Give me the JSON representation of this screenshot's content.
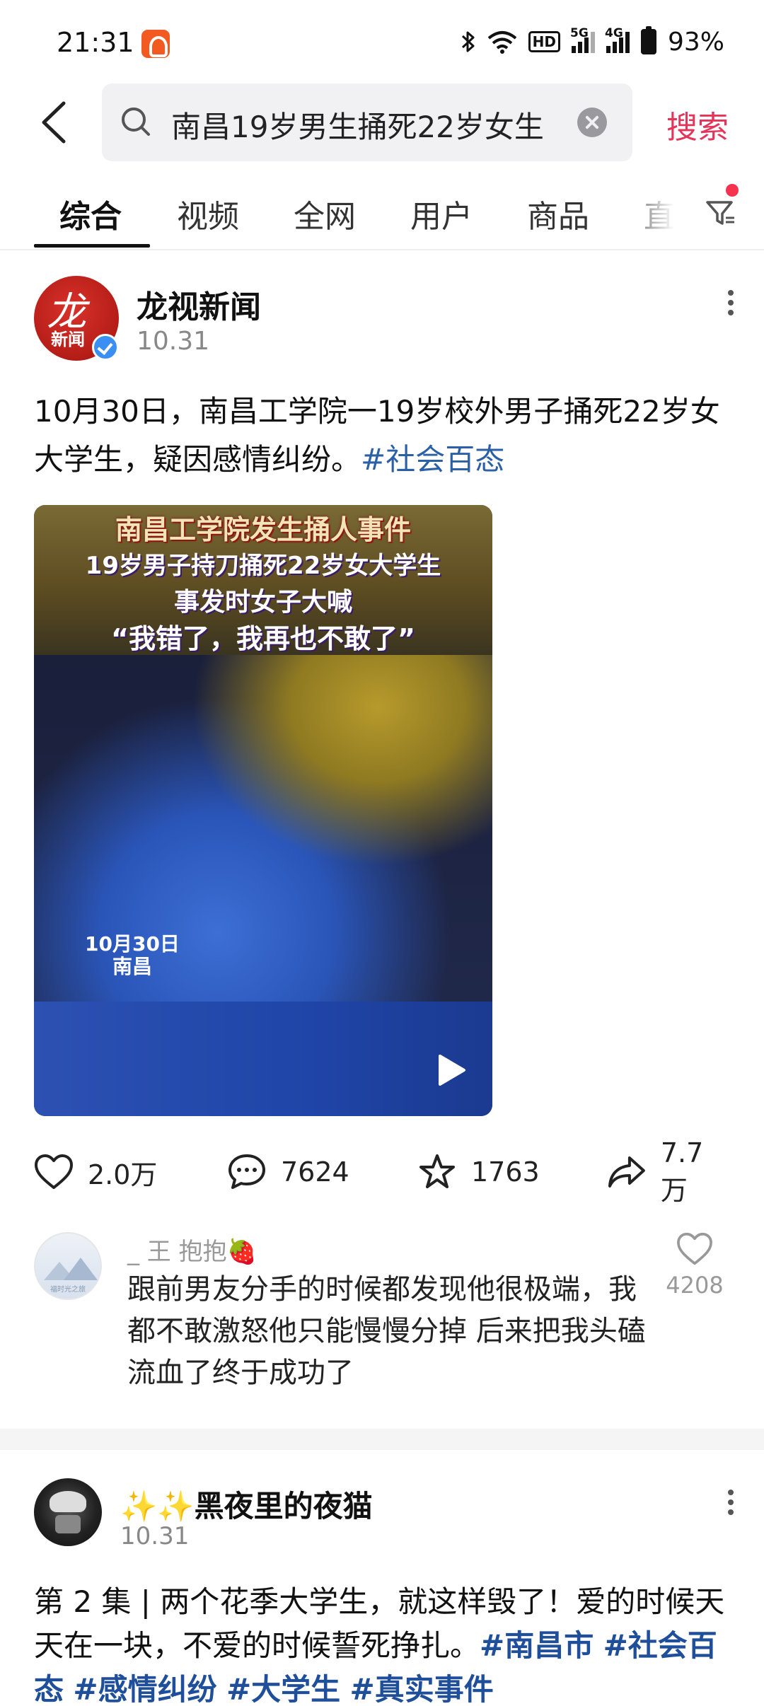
{
  "status_bar": {
    "time": "21:31",
    "hd_label": "HD",
    "net1_label": "5G",
    "net2_label": "4G",
    "battery": "93%"
  },
  "search": {
    "query": "南昌19岁男生捅死22岁女生",
    "submit_label": "搜索"
  },
  "tabs": [
    {
      "label": "综合",
      "active": true
    },
    {
      "label": "视频",
      "active": false
    },
    {
      "label": "全网",
      "active": false
    },
    {
      "label": "用户",
      "active": false
    },
    {
      "label": "商品",
      "active": false
    },
    {
      "label": "直",
      "active": false
    }
  ],
  "post1": {
    "author": "龙视新闻",
    "avatar_text_big": "龙",
    "avatar_text_small": "新闻",
    "date": "10.31",
    "text": "10月30日，南昌工学院一19岁校外男子捅死22岁女大学生，疑因感情纠纷。",
    "hashtag": "#社会百态",
    "video": {
      "line1": "南昌工学院发生捅人事件",
      "line2": "19岁男子持刀捅死22岁女大学生",
      "line3": "事发时女子大喊",
      "line4": "“我错了，我再也不敢了”",
      "date_overlay": "10月30日",
      "place_overlay": "南昌"
    },
    "actions": {
      "likes": "2.0万",
      "comments": "7624",
      "favorites": "1763",
      "shares": "7.7万"
    },
    "top_comment": {
      "username": "_ 王 抱抱🍓",
      "avatar_caption": "福时光之旅",
      "text": "跟前男友分手的时候都发现他很极端，我都不敢激怒他只能慢慢分掉 后来把我头磕流血了终于成功了",
      "likes": "4208"
    }
  },
  "post2": {
    "author": "✨✨黑夜里的夜猫",
    "date": "10.31",
    "text": "第 2 集 | 两个花季大学生，就这样毁了！爱的时候天天在一块，不爱的时候誓死挣扎。",
    "hashtags": [
      "#南昌市",
      "#社会百态",
      "#感情纠纷",
      "#大学生",
      "#真实事件"
    ]
  },
  "colors": {
    "accent_red": "#e4345a",
    "hashtag_blue": "#2b5fa6",
    "verified_blue": "#3a8ff5"
  }
}
